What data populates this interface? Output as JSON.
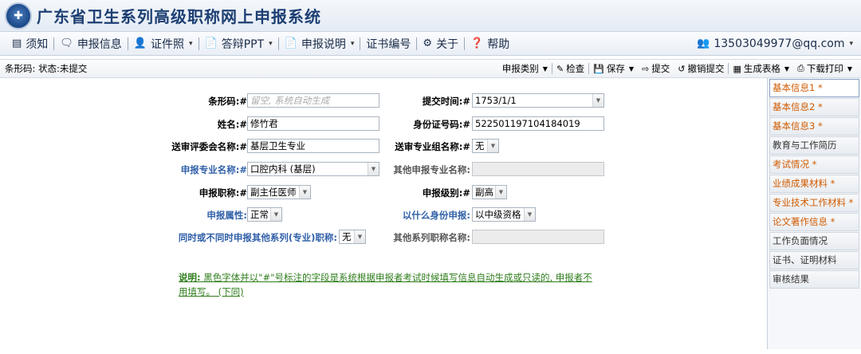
{
  "header": {
    "title": "广东省卫生系列高级职称网上申报系统"
  },
  "menu": {
    "items": [
      {
        "label": "须知",
        "icon": "▤"
      },
      {
        "label": "申报信息",
        "icon": "🗨"
      },
      {
        "label": "证件照",
        "icon": "👤",
        "dropdown": "▾"
      },
      {
        "label": "答辩PPT",
        "icon": "📄",
        "dropdown": "▾"
      },
      {
        "label": "申报说明",
        "icon": "📄",
        "dropdown": "▾"
      },
      {
        "label": "证书编号",
        "icon": ""
      },
      {
        "label": "关于",
        "icon": "⚙"
      },
      {
        "label": "帮助",
        "icon": "❓"
      }
    ],
    "user": {
      "label": "13503049977@qq.com",
      "icon": "👥",
      "dropdown": "▾"
    }
  },
  "status": {
    "text": "条形码: 状态:未提交"
  },
  "toolbar": {
    "category": "申报类别",
    "check": "检查",
    "save": "保存",
    "submit": "提交",
    "revoke": "撤销提交",
    "generate": "生成表格",
    "download": "下载打印"
  },
  "form": {
    "barcode_label": "条形码:#",
    "barcode_placeholder": "留空, 系统自动生成",
    "submit_time_label": "提交时间:#",
    "submit_time_value": "1753/1/1",
    "name_label": "姓名:#",
    "name_value": "修竹君",
    "id_label": "身份证号码:#",
    "id_value": "522501197104184019",
    "committee_label": "送审评委会名称:#",
    "committee_value": "基层卫生专业",
    "group_label": "送审专业组名称:#",
    "group_value": "无",
    "major_label": "申报专业名称:#",
    "major_value": "口腔内科 (基层)",
    "other_major_label": "其他申报专业名称:",
    "title_label": "申报职称:#",
    "title_value": "副主任医师",
    "level_label": "申报级别:#",
    "level_value": "副高",
    "attr_label": "申报属性:",
    "attr_value": "正常",
    "identity_label": "以什么身份申报:",
    "identity_value": "以中级资格",
    "other_series_q_label": "同时或不同时申报其他系列(专业)职称:",
    "other_series_q_value": "无",
    "other_series_name_label": "其他系列职称名称:"
  },
  "note": {
    "prefix": "说明:",
    "text": " 黑色字体并以\"#\"号标注的字段是系统根据申报者考试时候填写信息自动生成或只读的, 申报者不用填写。 (下同)"
  },
  "tabs": [
    {
      "label": "基本信息1 *",
      "req": true,
      "active": true
    },
    {
      "label": "基本信息2 *",
      "req": true
    },
    {
      "label": "基本信息3 *",
      "req": true
    },
    {
      "label": "教育与工作简历",
      "req": false
    },
    {
      "label": "考试情况 *",
      "req": true
    },
    {
      "label": "业绩成果材料 *",
      "req": true
    },
    {
      "label": "专业技术工作材料 *",
      "req": true
    },
    {
      "label": "论文著作信息 *",
      "req": true
    },
    {
      "label": "工作负面情况",
      "req": false
    },
    {
      "label": "证书、证明材料",
      "req": false
    },
    {
      "label": "审核结果",
      "req": false
    }
  ]
}
